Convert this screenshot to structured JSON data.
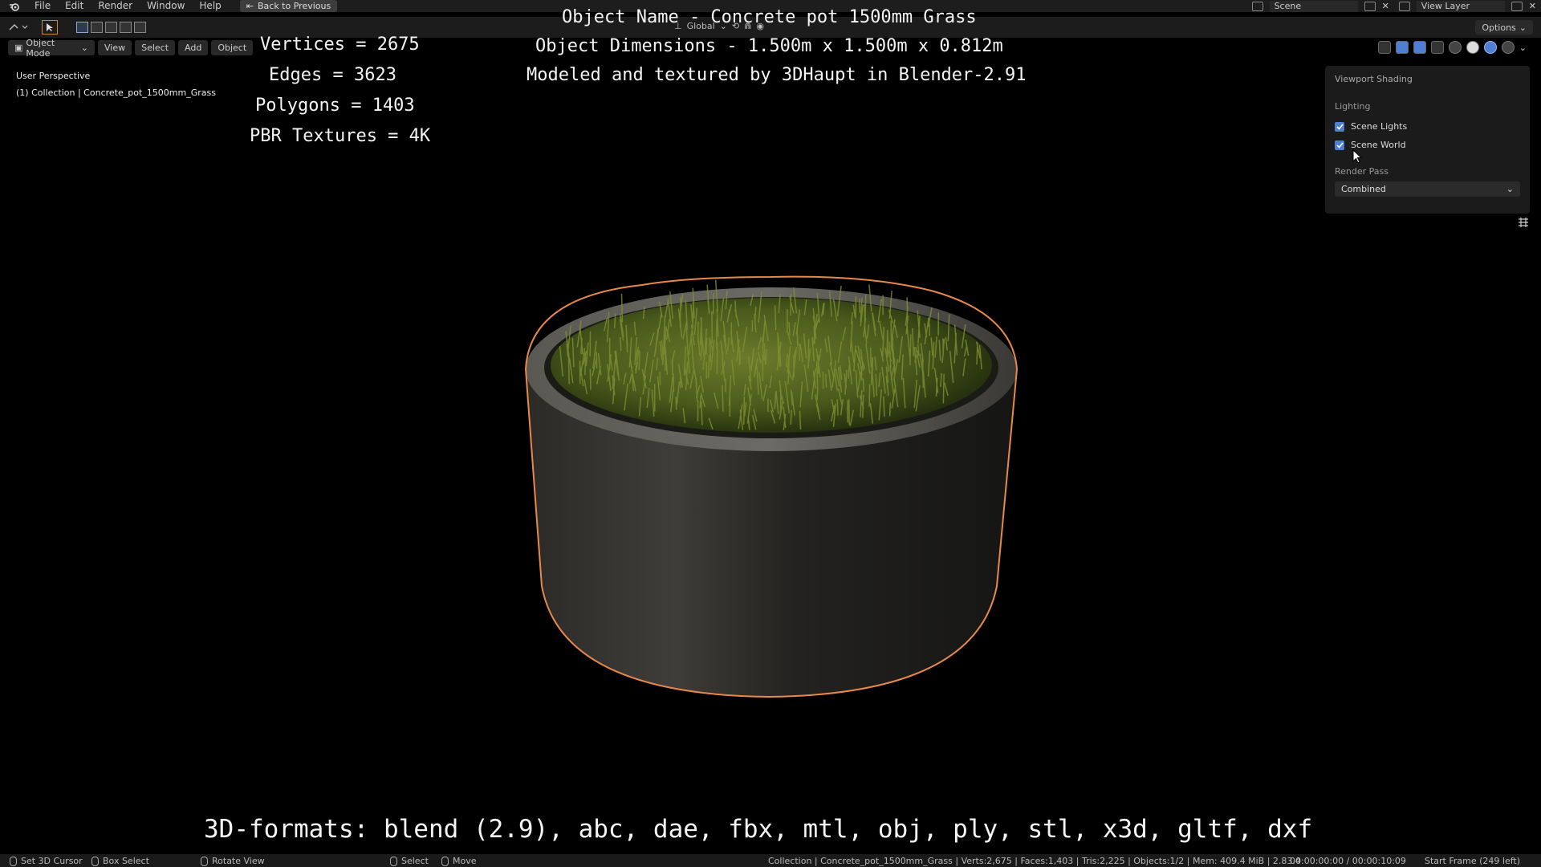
{
  "topbar": {
    "menus": [
      "File",
      "Edit",
      "Render",
      "Window",
      "Help"
    ],
    "back_button": "Back to Previous",
    "scene_label": "Scene",
    "view_layer_label": "View Layer"
  },
  "toolbar": {
    "pivot_label": "Global",
    "options_label": "Options"
  },
  "viewport_header": {
    "mode": "Object Mode",
    "menus": [
      "View",
      "Select",
      "Add",
      "Object"
    ]
  },
  "viewport_info": {
    "perspective": "User Perspective",
    "collection": "(1) Collection | Concrete_pot_1500mm_Grass"
  },
  "overlay": {
    "stats": {
      "vertices": "Vertices = 2675",
      "edges": "Edges = 3623",
      "polygons": "Polygons = 1403",
      "textures": "PBR Textures = 4K"
    },
    "object_name": "Object Name - Concrete pot 1500mm Grass",
    "dimensions": "Object Dimensions -  1.500m x 1.500m x 0.812m",
    "credit": "Modeled and textured by 3DHaupt in Blender-2.91",
    "formats": "3D-formats: blend (2.9), abc, dae, fbx, mtl, obj, ply, stl, x3d, gltf, dxf"
  },
  "shading_popover": {
    "title": "Viewport Shading",
    "lighting_label": "Lighting",
    "scene_lights": "Scene Lights",
    "scene_lights_checked": true,
    "scene_world": "Scene World",
    "scene_world_checked": true,
    "render_pass_label": "Render Pass",
    "render_pass_value": "Combined"
  },
  "statusbar": {
    "set_cursor": "Set 3D Cursor",
    "box_select": "Box Select",
    "rotate_view": "Rotate View",
    "select": "Select",
    "move": "Move",
    "stats": "Collection | Concrete_pot_1500mm_Grass | Verts:2,675 | Faces:1,403 | Tris:2,225 | Objects:1/2 | Mem: 409.4 MiB | 2.83.4",
    "time": "00:00:00:00 / 00:00:10:09",
    "frame": "Start Frame (249 left)"
  },
  "colors": {
    "selection_outline": "#e8894a",
    "accent": "#4f7fd3"
  }
}
